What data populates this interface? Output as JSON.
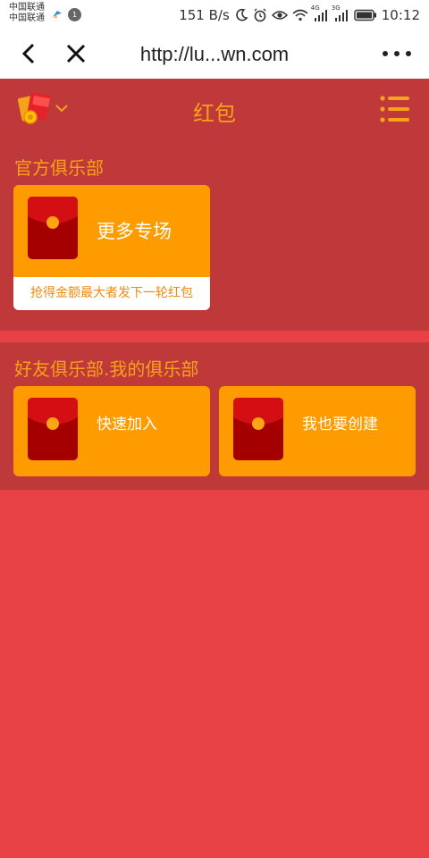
{
  "status_bar": {
    "carrier_1": "中国联通",
    "carrier_2": "中国联通",
    "notification_badge": "1",
    "net_speed": "151 B/s",
    "signal_1": "4G",
    "signal_2": "3G",
    "time": "10:12"
  },
  "browser": {
    "url": "http://lu...wn.com"
  },
  "header": {
    "title": "红包"
  },
  "official_club": {
    "title": "官方俱乐部",
    "card": {
      "label": "更多专场",
      "footer": "抢得金额最大者发下一轮红包"
    }
  },
  "friend_club": {
    "title": "好友俱乐部.我的俱乐部",
    "cards": [
      {
        "label": "快速加入"
      },
      {
        "label": "我也要创建"
      }
    ]
  },
  "colors": {
    "page_bg": "#e84145",
    "section_bg": "#c0393a",
    "accent": "#f6a21a",
    "card_bg": "#fd9b00",
    "envelope": "#b8000b"
  }
}
